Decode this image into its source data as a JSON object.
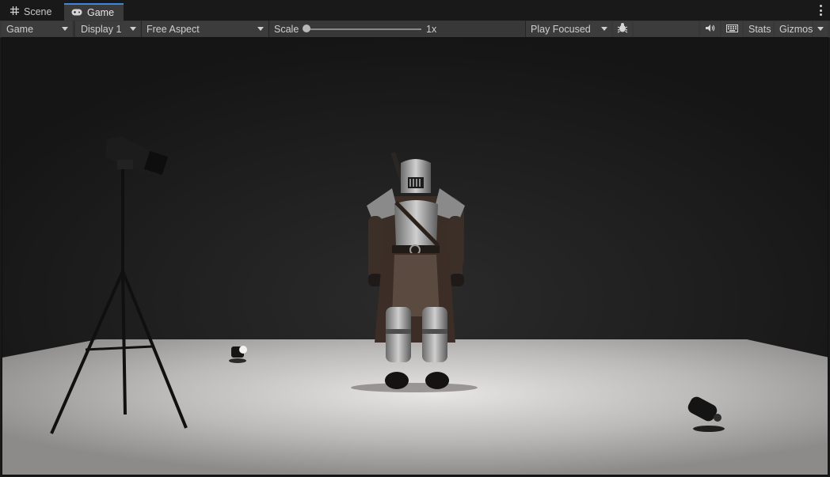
{
  "tabs": [
    {
      "label": "Scene",
      "icon": "grid-icon"
    },
    {
      "label": "Game",
      "icon": "gamepad-icon"
    }
  ],
  "toolbar": {
    "view_dropdown": "Game",
    "display_dropdown": "Display 1",
    "aspect_dropdown": "Free Aspect",
    "scale_label": "Scale",
    "scale_value": "1x",
    "scale_level": 0,
    "play_mode_dropdown": "Play Focused",
    "stats_label": "Stats",
    "gizmos_label": "Gizmos"
  },
  "colors": {
    "active_tab_accent": "#3d86e0",
    "toolbar_bg": "#383838",
    "floor": "#bdbbba"
  }
}
